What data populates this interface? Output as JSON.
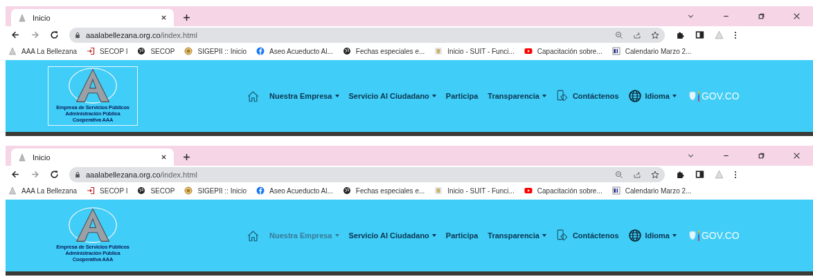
{
  "windows": [
    {
      "tab": {
        "title": "Inicio",
        "selected": true
      },
      "address": {
        "domain": "aaalabellezana.org.co",
        "path": "/index.html"
      },
      "bookmarks": [
        {
          "kind": "logo",
          "label": "AAA La Bellezana"
        },
        {
          "kind": "login",
          "label": "SECOP I"
        },
        {
          "kind": "globe",
          "label": "SECOP"
        },
        {
          "kind": "seal",
          "label": "SIGEPII :: Inicio"
        },
        {
          "kind": "facebook",
          "label": "Aseo Acueducto Al..."
        },
        {
          "kind": "globe",
          "label": "Fechas especiales e..."
        },
        {
          "kind": "shield",
          "label": "Inicio - SUIT - Funci..."
        },
        {
          "kind": "video",
          "label": "Capacitación sobre..."
        },
        {
          "kind": "calendar",
          "label": "Calendario Marzo 2..."
        }
      ],
      "header": {
        "logo_outlined": true,
        "logo_lines": [
          "Empresa de Servicios Públicos",
          "Administración Pública",
          "Cooperativa AAA"
        ],
        "nav": [
          {
            "kind": "home"
          },
          {
            "kind": "link",
            "label": "Nuestra Empresa",
            "dropdown": true,
            "dimmed": false
          },
          {
            "kind": "link",
            "label": "Servicio Al Ciudadano",
            "dropdown": true,
            "dimmed": false
          },
          {
            "kind": "link",
            "label": "Participa",
            "dropdown": false,
            "dimmed": false
          },
          {
            "kind": "link",
            "label": "Transparencia",
            "dropdown": true,
            "dimmed": false
          },
          {
            "kind": "contact",
            "label": "Contáctenos",
            "dropdown": false,
            "dimmed": false
          },
          {
            "kind": "globe",
            "label": "Idioma",
            "dropdown": true,
            "dimmed": false
          },
          {
            "kind": "gov",
            "label": "GOV.CO"
          }
        ]
      }
    },
    {
      "tab": {
        "title": "Inicio",
        "selected": true
      },
      "address": {
        "domain": "aaalabellezana.org.co",
        "path": "/index.html"
      },
      "bookmarks": [
        {
          "kind": "logo",
          "label": "AAA La Bellezana"
        },
        {
          "kind": "login",
          "label": "SECOP I"
        },
        {
          "kind": "globe",
          "label": "SECOP"
        },
        {
          "kind": "seal",
          "label": "SIGEPII :: Inicio"
        },
        {
          "kind": "facebook",
          "label": "Aseo Acueducto Al..."
        },
        {
          "kind": "globe",
          "label": "Fechas especiales e..."
        },
        {
          "kind": "shield",
          "label": "Inicio - SUIT - Funci..."
        },
        {
          "kind": "video",
          "label": "Capacitación sobre..."
        },
        {
          "kind": "calendar",
          "label": "Calendario Marzo 2..."
        }
      ],
      "header": {
        "logo_outlined": false,
        "logo_lines": [
          "Empresa de Servicios Públicos",
          "Administración Pública",
          "Cooperativa AAA"
        ],
        "nav": [
          {
            "kind": "home"
          },
          {
            "kind": "link",
            "label": "Nuestra Empresa",
            "dropdown": true,
            "dimmed": true
          },
          {
            "kind": "link",
            "label": "Servicio Al Ciudadano",
            "dropdown": true,
            "dimmed": false
          },
          {
            "kind": "link",
            "label": "Participa",
            "dropdown": false,
            "dimmed": false
          },
          {
            "kind": "link",
            "label": "Transparencia",
            "dropdown": true,
            "dimmed": false
          },
          {
            "kind": "contact",
            "label": "Contáctenos",
            "dropdown": false,
            "dimmed": false
          },
          {
            "kind": "globe",
            "label": "Idioma",
            "dropdown": true,
            "dimmed": false
          },
          {
            "kind": "gov",
            "label": "GOV.CO"
          }
        ]
      }
    }
  ]
}
